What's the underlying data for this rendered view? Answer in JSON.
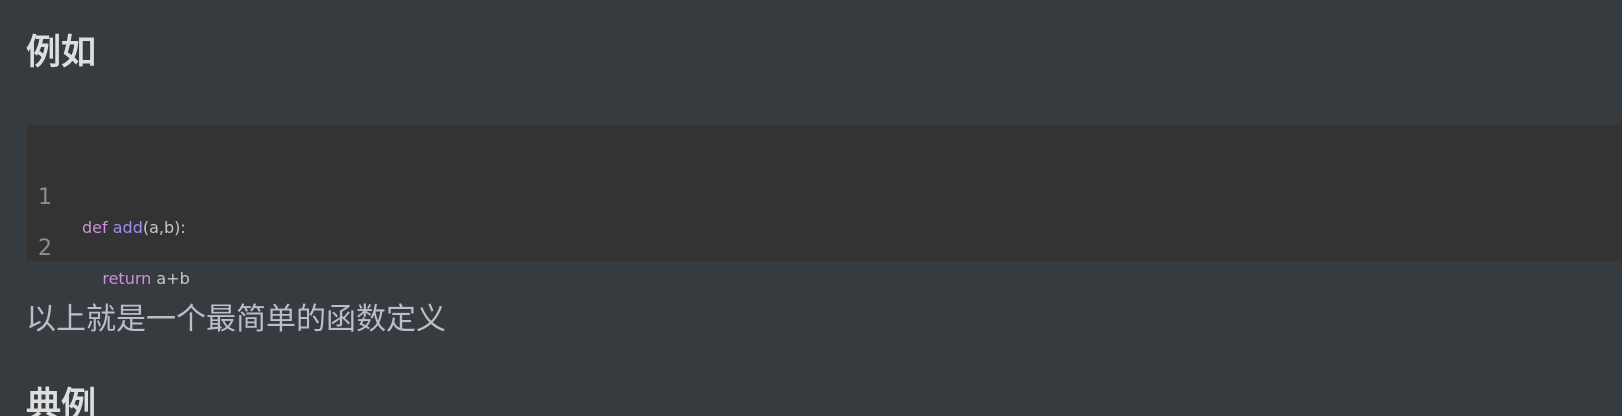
{
  "headings": {
    "first": "例如",
    "second": "典例"
  },
  "code_block": {
    "lines": [
      {
        "number": "1",
        "tokens": [
          {
            "text": "def",
            "kind": "keyword"
          },
          {
            "text": " ",
            "kind": "plain"
          },
          {
            "text": "add",
            "kind": "def"
          },
          {
            "text": "(a,b):",
            "kind": "plain"
          }
        ]
      },
      {
        "number": "2",
        "tokens": [
          {
            "text": "    ",
            "kind": "plain"
          },
          {
            "text": "return",
            "kind": "keyword"
          },
          {
            "text": " a+b",
            "kind": "plain"
          }
        ]
      }
    ]
  },
  "paragraph": {
    "text": "以上就是一个最简单的函数定义"
  },
  "colors": {
    "background": "#363b40",
    "code_background": "#333333",
    "keyword": "#cf8edb",
    "definition": "#9b8ff0",
    "plain_code": "#c8c8c8",
    "heading": "#dedede",
    "paragraph": "#b8bfc6"
  }
}
